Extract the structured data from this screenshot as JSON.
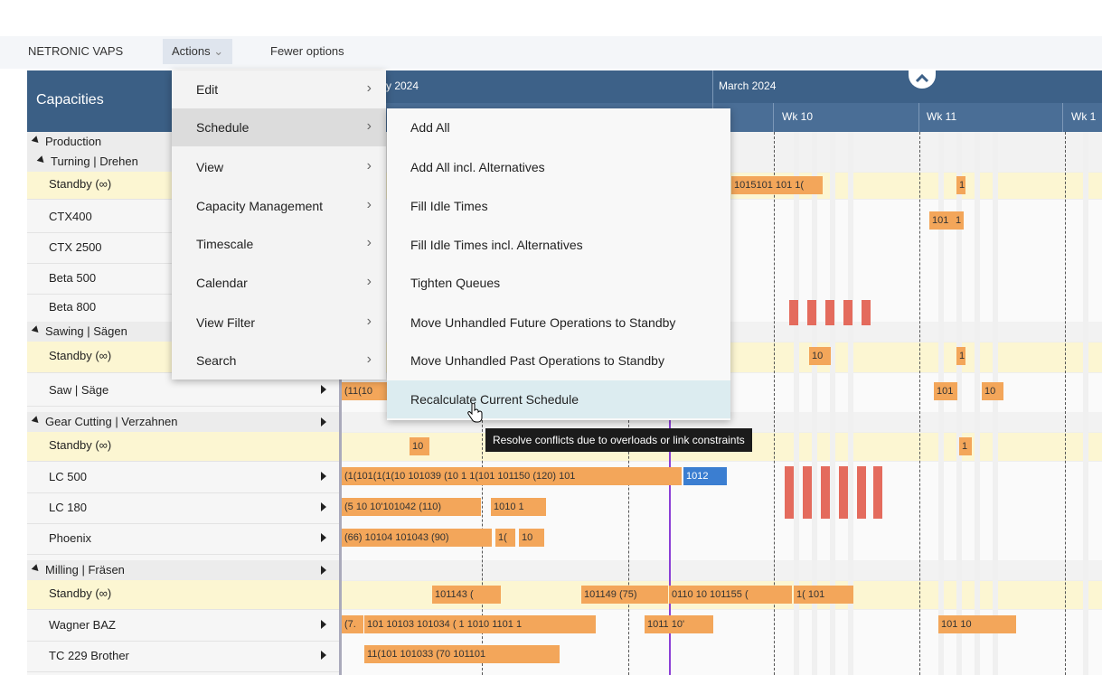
{
  "colors": {
    "header": "#3d6188",
    "bar": "#f3a65a",
    "standby": "#fcf6d2",
    "now_line": "#8b3fd6",
    "conflict": "#e46b5d"
  },
  "topbar": {
    "app_name": "NETRONIC VAPS",
    "actions_label": "Actions",
    "fewer_options": "Fewer options"
  },
  "header": {
    "panel_title": "Capacities",
    "month_1": "ry 2024",
    "month_2": "March 2024",
    "week_10": "Wk 10",
    "week_11": "Wk 11",
    "week_12": "Wk 1"
  },
  "resources": {
    "production": "Production",
    "turning": "Turning | Drehen",
    "standby_1": "Standby (∞)",
    "ctx400": "CTX400",
    "ctx2500": "CTX 2500",
    "beta500": "Beta 500",
    "beta800": "Beta 800",
    "sawing": "Sawing | Sägen",
    "standby_2": "Standby (∞)",
    "saw": "Saw | Säge",
    "gear": "Gear Cutting | Verzahnen",
    "standby_3": "Standby (∞)",
    "lc500": "LC 500",
    "lc180": "LC 180",
    "phoenix": "Phoenix",
    "milling": "Milling | Fräsen",
    "standby_4": "Standby (∞)",
    "wagner": "Wagner BAZ",
    "tc229": "TC 229 Brother"
  },
  "actions_menu": {
    "edit": "Edit",
    "schedule": "Schedule",
    "view": "View",
    "capacity": "Capacity Management",
    "timescale": "Timescale",
    "calendar": "Calendar",
    "view_filter": "View Filter",
    "search": "Search"
  },
  "schedule_menu": {
    "add_all": "Add All",
    "add_all_alt": "Add All incl. Alternatives",
    "fill_idle": "Fill Idle Times",
    "fill_idle_alt": "Fill Idle Times incl. Alternatives",
    "tighten": "Tighten Queues",
    "move_future": "Move Unhandled Future Operations to Standby",
    "move_past": "Move Unhandled Past Operations to Standby",
    "recalc": "Recalculate Current Schedule"
  },
  "tooltip": "Resolve conflicts due to overloads or link constraints",
  "bars": {
    "b1": "1015101 101 1(",
    "b2": "101",
    "b3": "1",
    "b4": "10",
    "b5": "(11(10",
    "b6": "10",
    "b7": "1",
    "b8": "(1(101(1(1(10 101039 (10 1 1(101 101150 (120) 101",
    "b9": "1012",
    "b10": "(5 10 10'101042 (110)",
    "b11": "1010 1",
    "b12": "(66) 10104 101043 (90)",
    "b13": "1(",
    "b14": "101143 (",
    "b15": "101149 (75)",
    "b16": "0110 10 101155 (",
    "b17": "1( 101",
    "b18": "(7.",
    "b19": "101 10103 101034 ( 1 1010 1101 1",
    "b20": "1011 10'",
    "b21": "11(101 101033 (70 101101",
    "b22": "101 10"
  }
}
